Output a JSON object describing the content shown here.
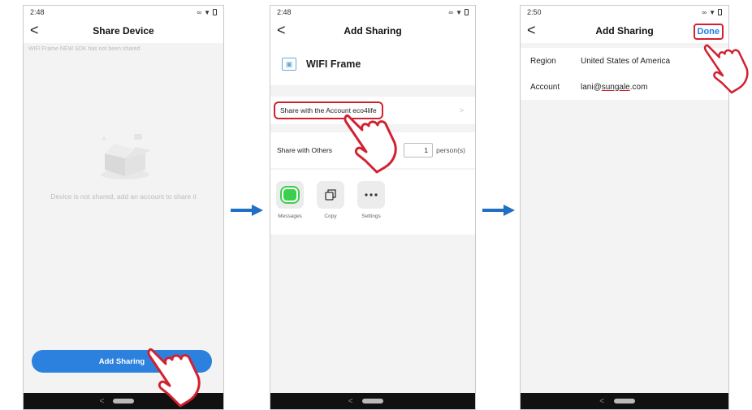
{
  "screens": [
    {
      "status_time": "2:48",
      "title": "Share Device",
      "back_glyph": "<",
      "info_text": "WIFI Frame  NEW SDK has not been shared",
      "empty_text": "Device is not shared, add an account to share it",
      "add_button": "Add Sharing",
      "bottom_chevron": "<"
    },
    {
      "status_time": "2:48",
      "title": "Add Sharing",
      "back_glyph": "<",
      "device_name": "WIFI Frame",
      "share_account_label": "Share with the Account eco4life",
      "row_arrow": ">",
      "share_others_label": "Share with Others",
      "person_count": "1",
      "person_unit": "person(s)",
      "targets": [
        {
          "label": "Messages",
          "icon": "messages-icon"
        },
        {
          "label": "Copy",
          "icon": "copy-icon"
        },
        {
          "label": "Settings",
          "icon": "more-icon"
        }
      ],
      "bottom_chevron": "<"
    },
    {
      "status_time": "2:50",
      "title": "Add Sharing",
      "back_glyph": "<",
      "done_label": "Done",
      "region_label": "Region",
      "region_value": "United States of America",
      "account_label": "Account",
      "account_prefix": "lani@",
      "account_domain": "sungale",
      "account_suffix": ".com",
      "bottom_chevron": "<"
    }
  ],
  "colors": {
    "primary_blue": "#2b81dd",
    "highlight_red": "#d3202f",
    "arrow_blue": "#1f6fc5"
  }
}
